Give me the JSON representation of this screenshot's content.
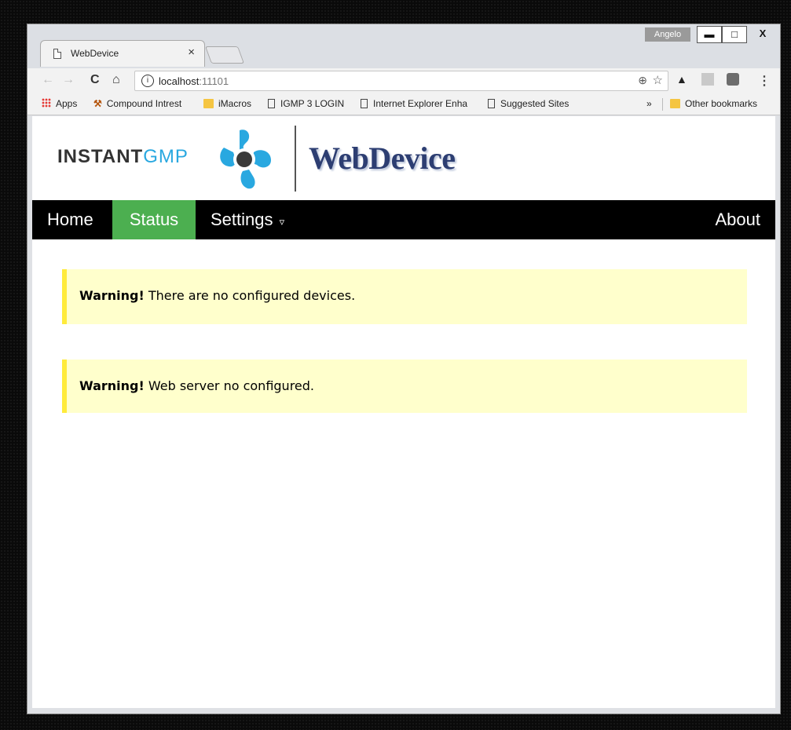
{
  "browser": {
    "tab_title": "WebDevice",
    "tab_close": "×",
    "user": "Angelo",
    "window_buttons": {
      "minimize": "▬",
      "maximize": "□",
      "close": "X"
    },
    "url_host": "localhost",
    "url_port": ":11101",
    "info_glyph": "i",
    "bookmarks": {
      "apps": "Apps",
      "compound": "Compound Intrest",
      "imacros": "iMacros",
      "igmp": "IGMP 3 LOGIN",
      "ie": "Internet Explorer Enha",
      "suggested": "Suggested Sites",
      "more": "»",
      "other": "Other bookmarks"
    }
  },
  "page": {
    "logo": {
      "instant": "INSTANT",
      "gmp": "GMP"
    },
    "brand": "WebDevice",
    "nav": {
      "home": "Home",
      "status": "Status",
      "settings": "Settings",
      "settings_caret": "▿",
      "about": "About"
    },
    "alerts": [
      {
        "label": "Warning!",
        "text": " There are no configured devices."
      },
      {
        "label": "Warning!",
        "text": " Web server no configured."
      }
    ]
  },
  "colors": {
    "active_nav": "#4caf50",
    "alert_bg": "#ffffcc",
    "alert_border": "#ffeb3b",
    "brand": "#2d3e72",
    "logo_blue": "#29a8e0"
  },
  "icons": [
    "page-icon",
    "back-arrow-icon",
    "forward-arrow-icon",
    "reload-icon",
    "home-icon",
    "info-icon",
    "zoom-icon",
    "star-icon",
    "graduation-cap-icon",
    "menu-dots-icon",
    "apps-grid-icon",
    "hammer-icon",
    "folder-icon",
    "document-icon"
  ]
}
